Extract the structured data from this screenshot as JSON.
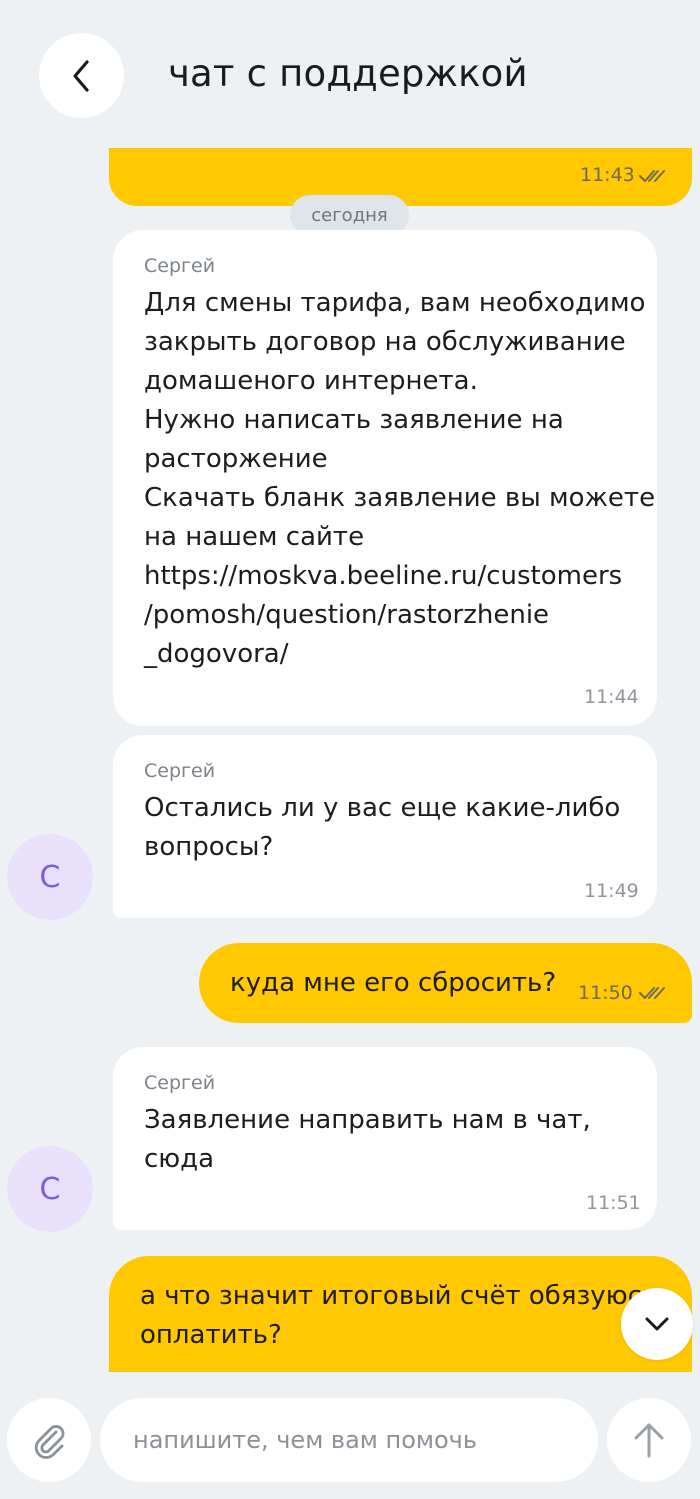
{
  "header": {
    "title": "чат с поддержкой",
    "back_icon": "chevron-left-icon"
  },
  "date_separator": "сегодня",
  "messages": [
    {
      "direction": "out",
      "text": "",
      "time": "11:43",
      "status": "read"
    },
    {
      "direction": "in",
      "sender": "Сергей",
      "lines": [
        "Для смены тарифа, вам необходимо",
        "закрыть договор на обслуживание",
        "домашеного интернета.",
        "Нужно написать заявление на",
        "расторжение",
        "Скачать бланк заявление вы можете",
        "на нашем сайте",
        "https://moskva.beeline.ru/customers",
        "/pomosh/question/rastorzhenie",
        "_dogovora/"
      ],
      "time": "11:44"
    },
    {
      "direction": "in",
      "sender": "Сергей",
      "lines": [
        "Остались ли у вас еще какие-либо",
        "вопросы?"
      ],
      "time": "11:49",
      "avatar": "С"
    },
    {
      "direction": "out",
      "text": "куда мне его сбросить?",
      "time": "11:50",
      "status": "read"
    },
    {
      "direction": "in",
      "sender": "Сергей",
      "lines": [
        "Заявление направить нам в чат,",
        "сюда"
      ],
      "time": "11:51",
      "avatar": "С"
    },
    {
      "direction": "out",
      "lines": [
        "а что значит итоговый счёт обязуюсь",
        "оплатить?"
      ]
    }
  ],
  "composer": {
    "placeholder": "напишите, чем вам помочь",
    "attach_icon": "paperclip-icon",
    "send_icon": "arrow-up-icon"
  },
  "scroll_down_icon": "chevron-down-icon",
  "colors": {
    "background": "#edf1f4",
    "outgoing_bubble": "#ffc800",
    "incoming_bubble": "#ffffff",
    "avatar_bg": "#e9e1fb",
    "avatar_text": "#7f5bd6"
  }
}
